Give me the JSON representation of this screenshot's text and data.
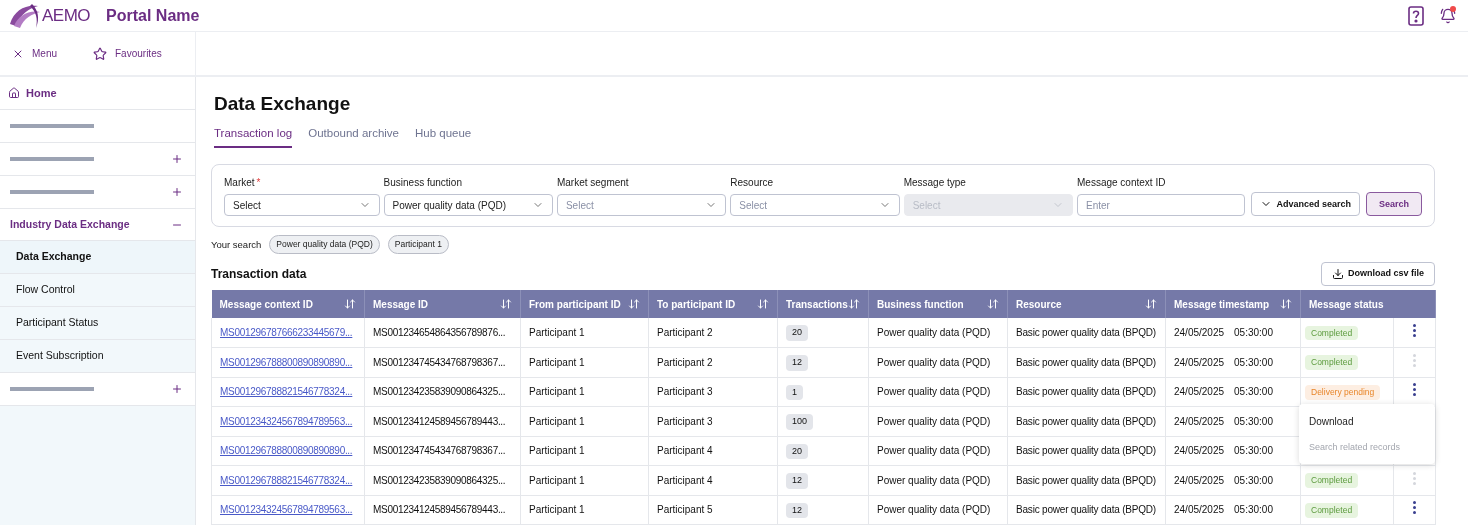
{
  "header": {
    "brand": "AEMO",
    "portal_name": "Portal Name",
    "notification_dot": true
  },
  "nav_bar": {
    "menu_label": "Menu",
    "favourites_label": "Favourites"
  },
  "sidebar": {
    "items": [
      {
        "kind": "link",
        "label": "Home"
      },
      {
        "kind": "redacted"
      },
      {
        "kind": "redacted",
        "expanded": false
      },
      {
        "kind": "redacted",
        "expanded": false
      },
      {
        "kind": "section",
        "label": "Industry Data Exchange",
        "expanded": true,
        "children": [
          {
            "label": "Data Exchange",
            "selected": true
          },
          {
            "label": "Flow Control",
            "selected": false
          },
          {
            "label": "Participant Status",
            "selected": false
          },
          {
            "label": "Event Subscription",
            "selected": false
          }
        ]
      },
      {
        "kind": "redacted",
        "expanded": false
      }
    ]
  },
  "page": {
    "title": "Data Exchange"
  },
  "tabs": [
    {
      "label": "Transaction log",
      "selected": true
    },
    {
      "label": "Outbound archive",
      "selected": false
    },
    {
      "label": "Hub queue",
      "selected": false
    }
  ],
  "filters": [
    {
      "kind": "select",
      "label": "Market",
      "required_mark": "*",
      "value": "Select",
      "disabled": false
    },
    {
      "kind": "select",
      "label": "Business function",
      "value": "Power quality data (PQD)",
      "disabled": false
    },
    {
      "kind": "select",
      "label": "Market segment",
      "placeholder": "Select",
      "disabled": false
    },
    {
      "kind": "select",
      "label": "Resource",
      "placeholder": "Select",
      "disabled": false
    },
    {
      "kind": "select",
      "label": "Message type",
      "placeholder": "Select",
      "disabled": true
    },
    {
      "kind": "input",
      "label": "Message context ID",
      "placeholder": "Enter",
      "disabled": false
    }
  ],
  "filter_buttons": {
    "advanced": "Advanced search",
    "search": "Search"
  },
  "your_search": {
    "label": "Your search",
    "chips": [
      "Power quality data (PQD)",
      "Participant 1"
    ]
  },
  "table": {
    "title": "Transaction data",
    "download_button": "Download csv file",
    "columns": [
      {
        "label": "Message context ID",
        "sortable": true
      },
      {
        "label": "Message ID",
        "sortable": true
      },
      {
        "label": "From participant ID",
        "sortable": true
      },
      {
        "label": "To participant ID",
        "sortable": true
      },
      {
        "label": "Transactions",
        "sortable": true
      },
      {
        "label": "Business function",
        "sortable": true
      },
      {
        "label": "Resource",
        "sortable": true
      },
      {
        "label": "Message timestamp",
        "sortable": true
      },
      {
        "label": "Message status",
        "sortable": false
      }
    ],
    "rows": [
      {
        "context_id": "MS001296787666233445679...",
        "message_id": "MS001234654864356789876...",
        "from": "Participant 1",
        "to": "Participant 2",
        "transactions": "20",
        "business_function": "Power quality data (PQD)",
        "resource": "Basic power quality data (BPQD)",
        "date": "24/05/2025",
        "time": "05:30:00",
        "status": {
          "label": "Completed",
          "kind": "completed"
        },
        "actions_disabled": false
      },
      {
        "context_id": "MS001296788800890890890...",
        "message_id": "MS001234745434768798367...",
        "from": "Participant 1",
        "to": "Participant 2",
        "transactions": "12",
        "business_function": "Power quality data (PQD)",
        "resource": "Basic power quality data (BPQD)",
        "date": "24/05/2025",
        "time": "05:30:00",
        "status": {
          "label": "Completed",
          "kind": "completed"
        },
        "actions_disabled": true
      },
      {
        "context_id": "MS001296788821546778324...",
        "message_id": "MS001234235839090864325...",
        "from": "Participant 1",
        "to": "Participant 3",
        "transactions": "1",
        "business_function": "Power quality data (PQD)",
        "resource": "Basic power quality data (BPQD)",
        "date": "24/05/2025",
        "time": "05:30:00",
        "status": {
          "label": "Delivery pending",
          "kind": "pending"
        },
        "actions_disabled": false,
        "menu": [
          {
            "label": "Download",
            "disabled": false
          },
          {
            "label": "Search related records",
            "disabled": true
          }
        ]
      },
      {
        "context_id": "MS001234324567894789563...",
        "message_id": "MS001234124589456789443...",
        "from": "Participant 1",
        "to": "Participant 3",
        "transactions": "100",
        "business_function": "Power quality data (PQD)",
        "resource": "Basic power quality data (BPQD)",
        "date": "24/05/2025",
        "time": "05:30:00"
      },
      {
        "context_id": "MS001296788800890890890...",
        "message_id": "MS001234745434768798367...",
        "from": "Participant 1",
        "to": "Participant 4",
        "transactions": "20",
        "business_function": "Power quality data (PQD)",
        "resource": "Basic power quality data (BPQD)",
        "date": "24/05/2025",
        "time": "05:30:00"
      },
      {
        "context_id": "MS001296788821546778324...",
        "message_id": "MS001234235839090864325...",
        "from": "Participant 1",
        "to": "Participant 4",
        "transactions": "12",
        "business_function": "Power quality data (PQD)",
        "resource": "Basic power quality data (BPQD)",
        "date": "24/05/2025",
        "time": "05:30:00",
        "status": {
          "label": "Completed",
          "kind": "completed"
        },
        "actions_disabled": true
      },
      {
        "context_id": "MS001234324567894789563...",
        "message_id": "MS001234124589456789443...",
        "from": "Participant 1",
        "to": "Participant 5",
        "transactions": "12",
        "business_function": "Power quality data (PQD)",
        "resource": "Basic power quality data (BPQD)",
        "date": "24/05/2025",
        "time": "05:30:00",
        "status": {
          "label": "Completed",
          "kind": "completed"
        },
        "actions_disabled": false
      }
    ]
  }
}
